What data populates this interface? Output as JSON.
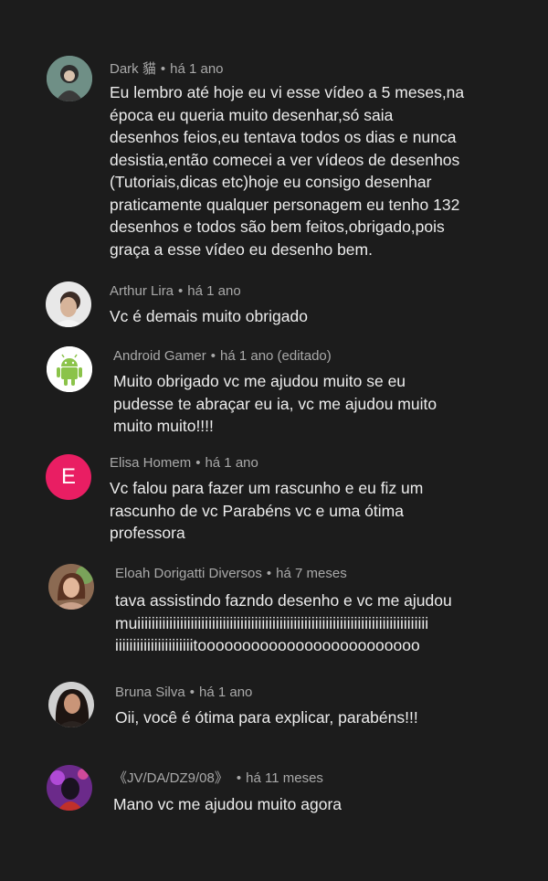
{
  "comments": [
    {
      "author": "Dark 貓",
      "time": "há 1 ano",
      "text": "Eu lembro até hoje eu vi esse vídeo a 5 meses,na\népoca eu queria muito desenhar,só saia\ndesenhos feios,eu tentava todos os dias e nunca\ndesistia,então comecei a ver vídeos de desenhos\n(Tutoriais,dicas etc)hoje eu consigo desenhar\npraticamente qualquer personagem eu tenho 132\ndesenhos e todos são bem feitos,obrigado,pois\ngraça a esse vídeo eu desenho bem."
    },
    {
      "author": "Arthur Lira",
      "time": "há 1 ano",
      "text": "Vc é demais muito obrigado"
    },
    {
      "author": "Android Gamer",
      "time": "há 1 ano (editado)",
      "text": "Muito obrigado vc me ajudou muito se eu\npudesse te abraçar eu ia, vc me ajudou muito\nmuito muito!!!!"
    },
    {
      "author": "Elisa Homem",
      "time": "há 1 ano",
      "avatar_letter": "E",
      "text": "Vc falou para fazer um rascunho e eu fiz um\nrascunho de vc Parabéns vc e uma ótima\nprofessora"
    },
    {
      "author": "Eloah Dorigatti Diversos",
      "time": "há 7 meses",
      "text": "tava assistindo fazndo desenho e vc me ajudou\nmuiiiiiiiiiiiiiiiiiiiiiiiiiiiiiiiiiiiiiiiiiiiiiiiiiiiiiiiiiiiiiiiiiiiiiiiiiiiiiiiiii\niiiiiiiiiiiiiiiiiiiiiitooooooooooooooooooooooooo"
    },
    {
      "author": "Bruna Silva",
      "time": "há 1 ano",
      "text": "Oii, você é ótima para explicar, parabéns!!!"
    },
    {
      "author": "《JV/DA/DZ9/08》",
      "time": "há 11 meses",
      "text": "Mano vc me ajudou muito agora"
    }
  ],
  "separator": "•",
  "colors": {
    "background": "#1c1c1c",
    "meta_text": "#a9a9a9",
    "body_text": "#ececec",
    "elisa_avatar": "#e91e63",
    "android_green": "#8bc34a"
  }
}
